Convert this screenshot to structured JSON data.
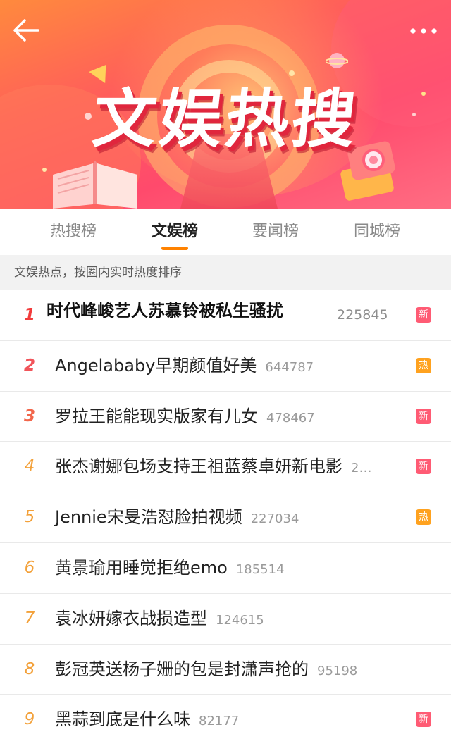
{
  "banner": {
    "title": "文娱热搜",
    "icons": [
      "back-arrow-icon",
      "more-dots-icon",
      "book-icon",
      "camera-icon",
      "planet-icon"
    ]
  },
  "tabs": [
    {
      "label": "热搜榜",
      "active": false
    },
    {
      "label": "文娱榜",
      "active": true
    },
    {
      "label": "要闻榜",
      "active": false
    },
    {
      "label": "同城榜",
      "active": false
    }
  ],
  "subtitle": "文娱热点，按圈内实时热度排序",
  "list": [
    {
      "rank": "1",
      "title": "时代峰峻艺人苏慕铃被私生骚扰",
      "count": "225845",
      "badge": "新"
    },
    {
      "rank": "2",
      "title": "Angelababy早期颜值好美",
      "count": "644787",
      "badge": "热"
    },
    {
      "rank": "3",
      "title": "罗拉王能能现实版家有儿女",
      "count": "478467",
      "badge": "新"
    },
    {
      "rank": "4",
      "title": "张杰谢娜包场支持王祖蓝蔡卓妍新电影",
      "count": "2…",
      "badge": "新"
    },
    {
      "rank": "5",
      "title": "Jennie宋旻浩怼脸拍视频",
      "count": "227034",
      "badge": "热"
    },
    {
      "rank": "6",
      "title": "黄景瑜用睡觉拒绝emo",
      "count": "185514",
      "badge": ""
    },
    {
      "rank": "7",
      "title": "袁冰妍嫁衣战损造型",
      "count": "124615",
      "badge": ""
    },
    {
      "rank": "8",
      "title": "彭冠英送杨子姗的包是封潇声抢的",
      "count": "95198",
      "badge": ""
    },
    {
      "rank": "9",
      "title": "黑蒜到底是什么味",
      "count": "82177",
      "badge": "新"
    }
  ],
  "colors": {
    "accent": "#ff8200",
    "badge_new": "#ff5b74",
    "badge_hot": "#ffa21f"
  }
}
